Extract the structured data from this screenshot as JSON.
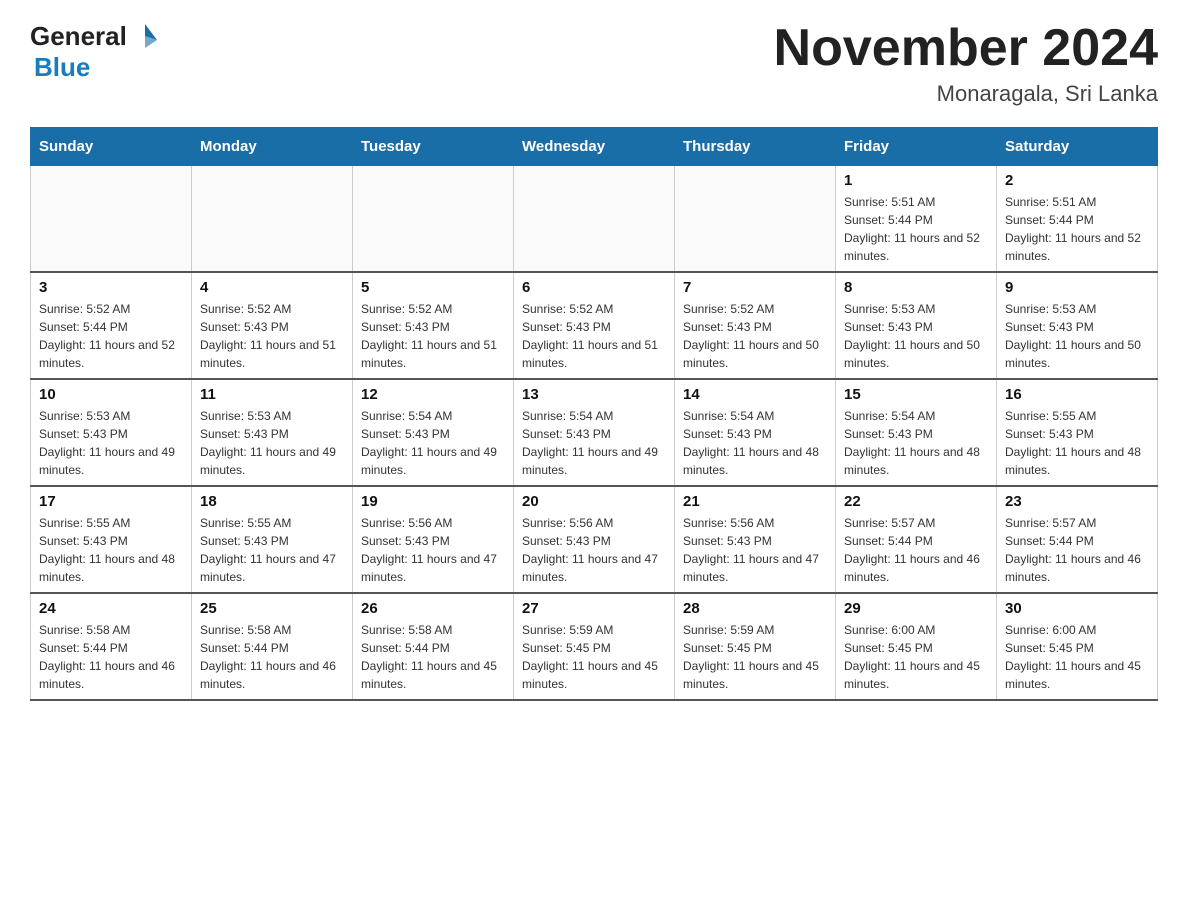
{
  "header": {
    "logo_general": "General",
    "logo_blue": "Blue",
    "title": "November 2024",
    "subtitle": "Monaragala, Sri Lanka"
  },
  "days_of_week": [
    "Sunday",
    "Monday",
    "Tuesday",
    "Wednesday",
    "Thursday",
    "Friday",
    "Saturday"
  ],
  "weeks": [
    {
      "days": [
        {
          "num": "",
          "info": ""
        },
        {
          "num": "",
          "info": ""
        },
        {
          "num": "",
          "info": ""
        },
        {
          "num": "",
          "info": ""
        },
        {
          "num": "",
          "info": ""
        },
        {
          "num": "1",
          "info": "Sunrise: 5:51 AM\nSunset: 5:44 PM\nDaylight: 11 hours and 52 minutes."
        },
        {
          "num": "2",
          "info": "Sunrise: 5:51 AM\nSunset: 5:44 PM\nDaylight: 11 hours and 52 minutes."
        }
      ]
    },
    {
      "days": [
        {
          "num": "3",
          "info": "Sunrise: 5:52 AM\nSunset: 5:44 PM\nDaylight: 11 hours and 52 minutes."
        },
        {
          "num": "4",
          "info": "Sunrise: 5:52 AM\nSunset: 5:43 PM\nDaylight: 11 hours and 51 minutes."
        },
        {
          "num": "5",
          "info": "Sunrise: 5:52 AM\nSunset: 5:43 PM\nDaylight: 11 hours and 51 minutes."
        },
        {
          "num": "6",
          "info": "Sunrise: 5:52 AM\nSunset: 5:43 PM\nDaylight: 11 hours and 51 minutes."
        },
        {
          "num": "7",
          "info": "Sunrise: 5:52 AM\nSunset: 5:43 PM\nDaylight: 11 hours and 50 minutes."
        },
        {
          "num": "8",
          "info": "Sunrise: 5:53 AM\nSunset: 5:43 PM\nDaylight: 11 hours and 50 minutes."
        },
        {
          "num": "9",
          "info": "Sunrise: 5:53 AM\nSunset: 5:43 PM\nDaylight: 11 hours and 50 minutes."
        }
      ]
    },
    {
      "days": [
        {
          "num": "10",
          "info": "Sunrise: 5:53 AM\nSunset: 5:43 PM\nDaylight: 11 hours and 49 minutes."
        },
        {
          "num": "11",
          "info": "Sunrise: 5:53 AM\nSunset: 5:43 PM\nDaylight: 11 hours and 49 minutes."
        },
        {
          "num": "12",
          "info": "Sunrise: 5:54 AM\nSunset: 5:43 PM\nDaylight: 11 hours and 49 minutes."
        },
        {
          "num": "13",
          "info": "Sunrise: 5:54 AM\nSunset: 5:43 PM\nDaylight: 11 hours and 49 minutes."
        },
        {
          "num": "14",
          "info": "Sunrise: 5:54 AM\nSunset: 5:43 PM\nDaylight: 11 hours and 48 minutes."
        },
        {
          "num": "15",
          "info": "Sunrise: 5:54 AM\nSunset: 5:43 PM\nDaylight: 11 hours and 48 minutes."
        },
        {
          "num": "16",
          "info": "Sunrise: 5:55 AM\nSunset: 5:43 PM\nDaylight: 11 hours and 48 minutes."
        }
      ]
    },
    {
      "days": [
        {
          "num": "17",
          "info": "Sunrise: 5:55 AM\nSunset: 5:43 PM\nDaylight: 11 hours and 48 minutes."
        },
        {
          "num": "18",
          "info": "Sunrise: 5:55 AM\nSunset: 5:43 PM\nDaylight: 11 hours and 47 minutes."
        },
        {
          "num": "19",
          "info": "Sunrise: 5:56 AM\nSunset: 5:43 PM\nDaylight: 11 hours and 47 minutes."
        },
        {
          "num": "20",
          "info": "Sunrise: 5:56 AM\nSunset: 5:43 PM\nDaylight: 11 hours and 47 minutes."
        },
        {
          "num": "21",
          "info": "Sunrise: 5:56 AM\nSunset: 5:43 PM\nDaylight: 11 hours and 47 minutes."
        },
        {
          "num": "22",
          "info": "Sunrise: 5:57 AM\nSunset: 5:44 PM\nDaylight: 11 hours and 46 minutes."
        },
        {
          "num": "23",
          "info": "Sunrise: 5:57 AM\nSunset: 5:44 PM\nDaylight: 11 hours and 46 minutes."
        }
      ]
    },
    {
      "days": [
        {
          "num": "24",
          "info": "Sunrise: 5:58 AM\nSunset: 5:44 PM\nDaylight: 11 hours and 46 minutes."
        },
        {
          "num": "25",
          "info": "Sunrise: 5:58 AM\nSunset: 5:44 PM\nDaylight: 11 hours and 46 minutes."
        },
        {
          "num": "26",
          "info": "Sunrise: 5:58 AM\nSunset: 5:44 PM\nDaylight: 11 hours and 45 minutes."
        },
        {
          "num": "27",
          "info": "Sunrise: 5:59 AM\nSunset: 5:45 PM\nDaylight: 11 hours and 45 minutes."
        },
        {
          "num": "28",
          "info": "Sunrise: 5:59 AM\nSunset: 5:45 PM\nDaylight: 11 hours and 45 minutes."
        },
        {
          "num": "29",
          "info": "Sunrise: 6:00 AM\nSunset: 5:45 PM\nDaylight: 11 hours and 45 minutes."
        },
        {
          "num": "30",
          "info": "Sunrise: 6:00 AM\nSunset: 5:45 PM\nDaylight: 11 hours and 45 minutes."
        }
      ]
    }
  ]
}
